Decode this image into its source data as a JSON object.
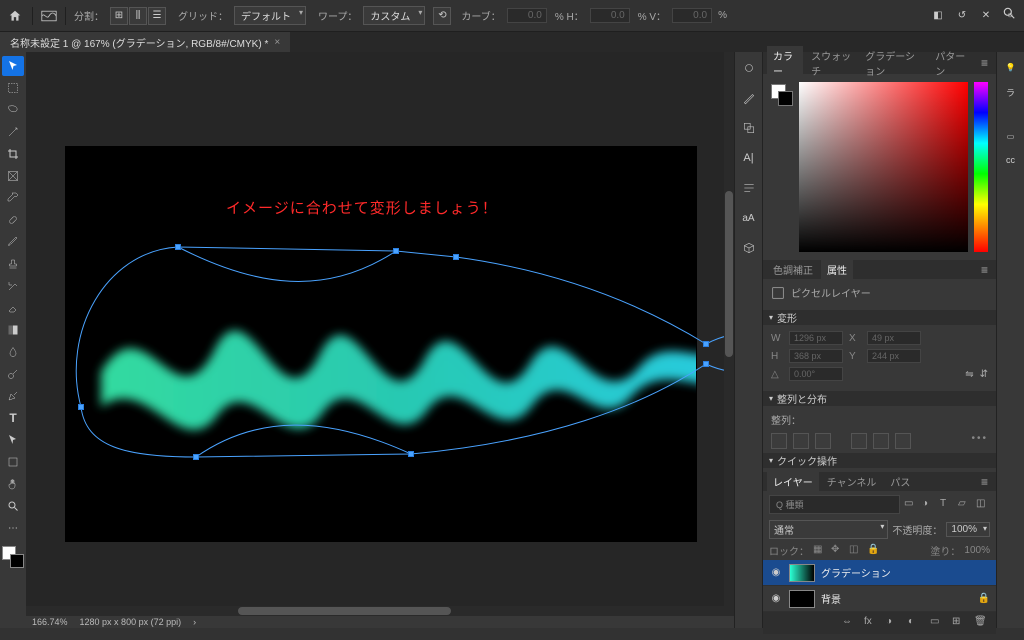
{
  "menubar": {
    "split_label": "分割：",
    "grid_label": "グリッド：",
    "grid_value": "デフォルト",
    "warp_label": "ワープ：",
    "warp_value": "カスタム",
    "curve_label": "カーブ：",
    "curve_value": "0.0",
    "h_label": "% H：",
    "h_value": "0.0",
    "v_label": "% V：",
    "v_value": "0.0",
    "pct": "%"
  },
  "doc_tab": {
    "title": "名称未設定 1 @ 167% (グラデーション, RGB/8#/CMYK) *"
  },
  "canvas": {
    "overlay_text": "イメージに合わせて変形しましょう！"
  },
  "status": {
    "zoom": "166.74%",
    "docinfo": "1280 px x 800 px (72 ppi)"
  },
  "panels": {
    "color": {
      "tabs": [
        "カラー",
        "スウォッチ",
        "グラデーション",
        "パターン"
      ],
      "active": 0
    },
    "adjust_tabs": [
      "色調補正",
      "属性"
    ],
    "adjust_active": 1,
    "layer_type": "ピクセルレイヤー",
    "transform_head": "変形",
    "transform": {
      "w_label": "W",
      "w_value": "1296 px",
      "x_label": "X",
      "x_value": "49 px",
      "h_label": "H",
      "h_value": "368 px",
      "y_label": "Y",
      "y_value": "244 px",
      "angle_value": "0.00°"
    },
    "aligndist_head": "整列と分布",
    "align_label": "整列：",
    "quick_head": "クイック操作",
    "layers_tabs": [
      "レイヤー",
      "チャンネル",
      "パス"
    ],
    "layers_active": 0,
    "search_placeholder": "Q 種類",
    "blend_mode": "通常",
    "opacity_label": "不透明度：",
    "opacity_value": "100%",
    "lock_label": "ロック：",
    "fill_label": "塗り：",
    "fill_value": "100%",
    "layer_items": [
      {
        "name": "グラデーション",
        "active": true,
        "thumb": "grad",
        "locked": false
      },
      {
        "name": "背景",
        "active": false,
        "thumb": "black",
        "locked": true
      }
    ]
  },
  "dock": {
    "libs": "ラ",
    "cc": "cc"
  }
}
